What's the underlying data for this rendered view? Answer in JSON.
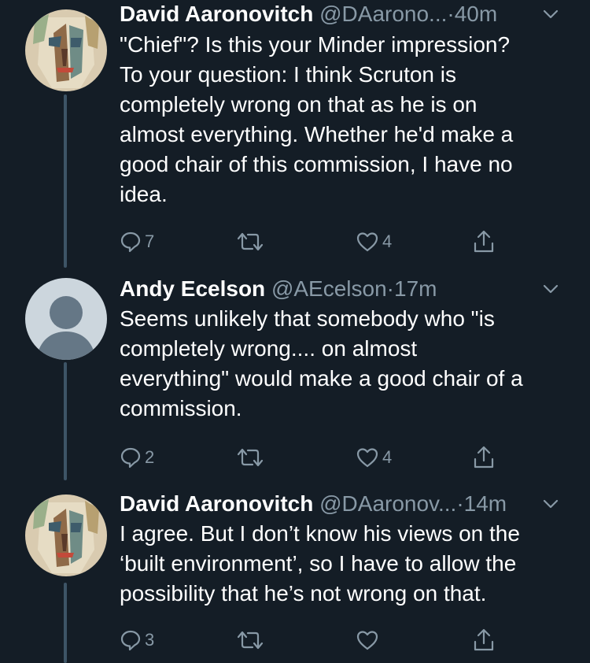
{
  "tweets": [
    {
      "name": "David Aaronovitch",
      "handle": "@DAarono...",
      "dot": "·",
      "time": "40m",
      "lines": [
        "\"Chief\"? Is this your Minder impression?",
        "To your question: I think Scruton is",
        "completely wrong on that as he is on",
        "almost everything. Whether he'd make a",
        "good chair of this commission, I have no",
        "idea."
      ],
      "replies": "7",
      "retweets": "",
      "likes": "4",
      "avatar": "abstract-portrait-painting"
    },
    {
      "name": "Andy Ecelson",
      "handle": "@AEcelson",
      "dot": "·",
      "time": "17m",
      "lines": [
        "Seems unlikely that somebody who \"is",
        "completely wrong.... on almost",
        "everything\" would make a good chair of a",
        "commission."
      ],
      "replies": "2",
      "retweets": "",
      "likes": "4",
      "avatar": "default-profile"
    },
    {
      "name": "David Aaronovitch",
      "handle": "@DAaronov...",
      "dot": "·",
      "time": "14m",
      "lines": [
        "I agree. But I don’t know his views on the",
        "‘built environment’,  so I have to allow the",
        "possibility that he’s not wrong on that."
      ],
      "replies": "3",
      "retweets": "",
      "likes": "",
      "avatar": "abstract-portrait-painting"
    }
  ],
  "colors": {
    "background": "#141d26",
    "secondary_text": "#8899a6",
    "thread_line": "#3d5466"
  }
}
